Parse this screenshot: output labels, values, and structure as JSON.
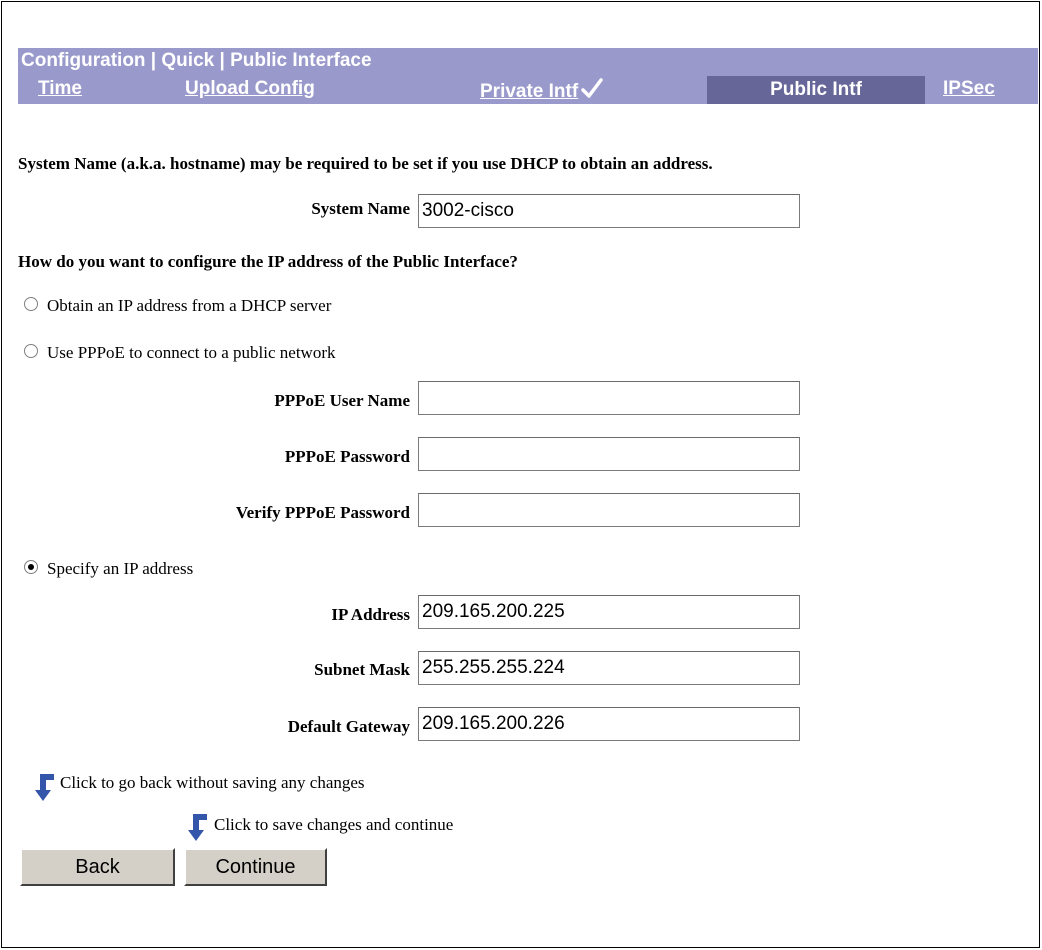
{
  "header": {
    "title": "Configuration | Quick | Public Interface",
    "tabs": {
      "time": "Time",
      "upload_config": "Upload Config",
      "private_intf": "Private Intf",
      "public_intf": "Public Intf",
      "ipsec": "IPSec"
    }
  },
  "form": {
    "system_name_note": "System Name (a.k.a. hostname) may be required to be set if you use DHCP to obtain an address.",
    "system_name_label": "System Name",
    "system_name_value": "3002-cisco",
    "ip_question": "How do you want to configure the IP address of the Public Interface?",
    "radio_dhcp": "Obtain an IP address from a DHCP server",
    "radio_pppoe": "Use PPPoE to connect to a public network",
    "pppoe_user_label": "PPPoE User Name",
    "pppoe_user_value": "",
    "pppoe_password_label": "PPPoE Password",
    "pppoe_password_value": "",
    "pppoe_verify_label": "Verify PPPoE Password",
    "pppoe_verify_value": "",
    "radio_static": "Specify an IP address",
    "selected_option": "static",
    "ip_address_label": "IP Address",
    "ip_address_value": "209.165.200.225",
    "subnet_mask_label": "Subnet Mask",
    "subnet_mask_value": "255.255.255.224",
    "gateway_label": "Default Gateway",
    "gateway_value": "209.165.200.226"
  },
  "actions": {
    "back_hint": "Click to go back without saving any changes",
    "continue_hint": "Click to save changes and continue",
    "back_label": "Back",
    "continue_label": "Continue"
  },
  "colors": {
    "header_bg": "#9999cc",
    "active_tab_bg": "#666699",
    "arrow": "#3355aa"
  },
  "icons": {
    "check": "check-icon",
    "arrow": "down-arrow-icon"
  }
}
